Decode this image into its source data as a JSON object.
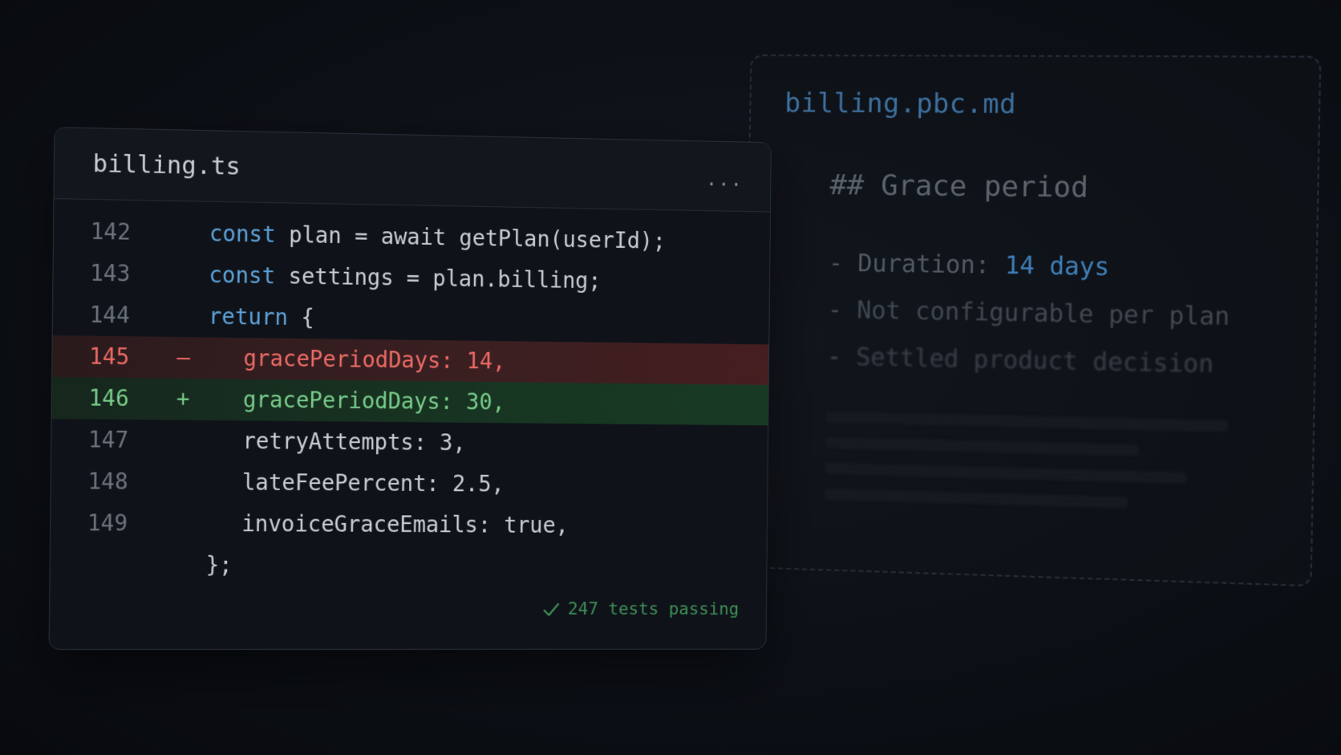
{
  "spec": {
    "filename": "billing.pbc.md",
    "heading": "## Grace period",
    "bullets": [
      {
        "dash": "-",
        "label": "Duration: ",
        "highlight": "14 days"
      },
      {
        "dash": "-",
        "label": "Not configurable per plan"
      },
      {
        "dash": "-",
        "label": "Settled product decision"
      }
    ]
  },
  "editor": {
    "filename": "billing.ts",
    "menu": "...",
    "lines": [
      {
        "number": "142",
        "marker": "",
        "keyword": "const",
        "text": " plan = await getPlan(userId);"
      },
      {
        "number": "143",
        "marker": "",
        "keyword": "const",
        "text": " settings = plan.billing;"
      },
      {
        "number": "144",
        "marker": "",
        "keyword": "return",
        "text": " {"
      },
      {
        "number": "145",
        "marker": "–",
        "keyword": "",
        "text": "gracePeriodDays: 14,"
      },
      {
        "number": "146",
        "marker": "+",
        "keyword": "",
        "text": "gracePeriodDays: 30,"
      },
      {
        "number": "147",
        "marker": "",
        "keyword": "",
        "text": "retryAttempts: 3,"
      },
      {
        "number": "148",
        "marker": "",
        "keyword": "",
        "text": "lateFeePercent: 2.5,"
      },
      {
        "number": "149",
        "marker": "",
        "keyword": "",
        "text": "invoiceGraceEmails: true,"
      },
      {
        "number": "",
        "marker": "",
        "keyword": "",
        "text": "};"
      }
    ],
    "status": "247 tests passing"
  },
  "colors": {
    "keyword": "#5ea2d9",
    "removed": "#ee6b66",
    "added": "#79cd8a",
    "status": "#3f8f57"
  }
}
